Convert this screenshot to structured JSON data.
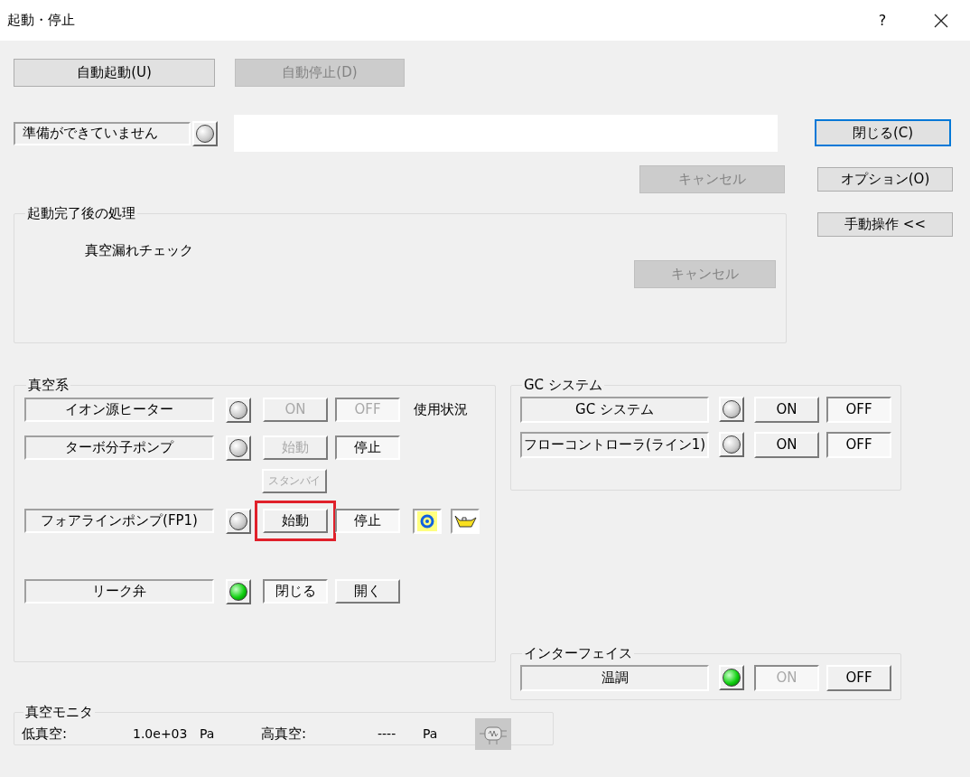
{
  "window": {
    "title": "起動・停止",
    "help": "?"
  },
  "auto_buttons": [
    {
      "label": "自動起動(U)",
      "disabled": false
    },
    {
      "label": "自動停止(D)",
      "disabled": true
    }
  ],
  "status": {
    "label": "準備ができていません",
    "lamp_on": false
  },
  "cancel_button": {
    "label": "キャンセル",
    "disabled": true
  },
  "side_buttons": [
    {
      "label": "閉じる(C)",
      "default": true
    },
    {
      "label": "オプション(O)",
      "default": false
    },
    {
      "label": "手動操作 <<",
      "default": false
    }
  ],
  "post_start": {
    "title": "起動完了後の処理",
    "task": "真空漏れチェック",
    "cancel_button": {
      "label": "キャンセル",
      "disabled": true
    }
  },
  "vacuum": {
    "title": "真空系",
    "rows": [
      {
        "label": "イオン源ヒーター",
        "lamp_on": false,
        "buttons": [
          {
            "label": "ON",
            "disabled": true,
            "pressed": false,
            "highlighted": false
          },
          {
            "label": "OFF",
            "disabled": true,
            "pressed": true,
            "highlighted": false
          }
        ],
        "note": "使用状況"
      },
      {
        "label": "ターボ分子ポンプ",
        "lamp_on": false,
        "buttons": [
          {
            "label": "始動",
            "disabled": true,
            "pressed": false,
            "highlighted": false
          },
          {
            "label": "停止",
            "disabled": false,
            "pressed": true,
            "highlighted": false
          }
        ],
        "sub_button": {
          "label": "スタンバイ",
          "disabled": true,
          "pressed": false,
          "highlighted": false
        }
      },
      {
        "label": "フォアラインポンプ(FP1)",
        "lamp_on": false,
        "buttons": [
          {
            "label": "始動",
            "disabled": false,
            "pressed": false,
            "highlighted": true
          },
          {
            "label": "停止",
            "disabled": false,
            "pressed": true,
            "highlighted": false
          }
        ],
        "tool_icons": true
      },
      {
        "label": "リーク弁",
        "lamp_on": true,
        "buttons": [
          {
            "label": "閉じる",
            "disabled": false,
            "pressed": true,
            "highlighted": false
          },
          {
            "label": "開く",
            "disabled": false,
            "pressed": false,
            "highlighted": false
          }
        ]
      }
    ]
  },
  "gc_system": {
    "title": "GC システム",
    "rows": [
      {
        "label": "GC システム",
        "lamp_on": false,
        "buttons": [
          {
            "label": "ON",
            "disabled": false,
            "pressed": false,
            "highlighted": false
          },
          {
            "label": "OFF",
            "disabled": false,
            "pressed": true,
            "highlighted": false
          }
        ]
      },
      {
        "label": "フローコントローラ(ライン1)",
        "lamp_on": false,
        "buttons": [
          {
            "label": "ON",
            "disabled": false,
            "pressed": false,
            "highlighted": false
          },
          {
            "label": "OFF",
            "disabled": false,
            "pressed": true,
            "highlighted": false
          }
        ]
      }
    ]
  },
  "interface": {
    "title": "インターフェイス",
    "rows": [
      {
        "label": "温調",
        "lamp_on": true,
        "buttons": [
          {
            "label": "ON",
            "disabled": true,
            "pressed": true,
            "highlighted": false
          },
          {
            "label": "OFF",
            "disabled": false,
            "pressed": false,
            "highlighted": false
          }
        ]
      }
    ]
  },
  "monitor": {
    "title": "真空モニタ",
    "readings": [
      {
        "label": "低真空:",
        "value": "1.0e+03",
        "unit": "Pa"
      },
      {
        "label": "高真空:",
        "value": "----",
        "unit": "Pa"
      }
    ]
  }
}
